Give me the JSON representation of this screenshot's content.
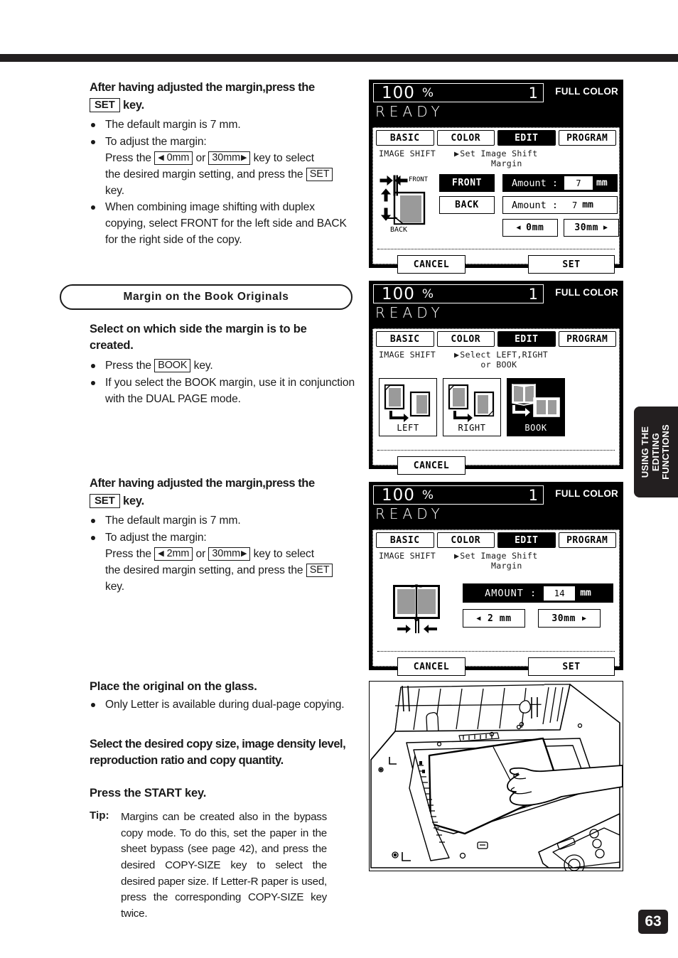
{
  "page": {
    "number": "63",
    "side_tab": "USING THE\nEDITING\nFUNCTIONS"
  },
  "steps": [
    {
      "id": "step-set-key-1",
      "heading_line1": "After having adjusted the margin,press the",
      "heading_key": "SET",
      "heading_line2": "key.",
      "bullets": [
        {
          "text": "The default margin is 7 mm."
        },
        {
          "text": "To adjust the margin:",
          "cont_pre": "Press the ",
          "key_left": "0mm",
          "cont_mid": " or ",
          "key_right": "30mm",
          "cont_post": " key to select",
          "cont_line2_pre": "the desired margin setting, and press the ",
          "key_set": "SET",
          "cont_line3": "key."
        },
        {
          "text": "When combining image shifting with duplex copying, select FRONT for the left side and BACK for the right side of the copy."
        }
      ]
    },
    {
      "id": "step-select-side",
      "heading": "Select on which side the margin is to be created.",
      "bullets": [
        {
          "pre": "Press the ",
          "key": "BOOK",
          "post": " key."
        },
        {
          "text": "If you select the  BOOK  margin, use it in conjunction with the DUAL PAGE mode."
        }
      ]
    },
    {
      "id": "step-set-key-2",
      "heading_line1": "After having adjusted the margin,press the",
      "heading_key": "SET",
      "heading_line2": "key.",
      "bullets": [
        {
          "text": "The default margin is 7 mm."
        },
        {
          "text": "To adjust the margin:",
          "cont_pre": "Press the ",
          "key_left": "2mm",
          "cont_mid": " or ",
          "key_right": "30mm",
          "cont_post": " key to select",
          "cont_line2_pre": "the desired margin setting, and press the ",
          "key_set": "SET",
          "cont_line3": "key."
        }
      ]
    },
    {
      "id": "step-place-original",
      "heading": "Place the original on the glass.",
      "bullets": [
        {
          "text": "Only Letter is available during dual-page copying."
        }
      ]
    },
    {
      "id": "step-select-copy-size",
      "heading": "Select the desired copy size, image density level, reproduction ratio and copy quantity."
    },
    {
      "id": "step-press-start",
      "heading": "Press the START key."
    }
  ],
  "section_title": "Margin on the Book Originals",
  "tip": {
    "label": "Tip:",
    "text": "Margins can be created also in the bypass copy mode. To do this, set the paper in the sheet bypass (see page 42), and press the desired COPY-SIZE key to select the desired paper size. If Letter-R paper is used, press the corresponding COPY-SIZE key twice."
  },
  "lcd_common": {
    "ratio": "100",
    "percent": "%",
    "copies": "1",
    "color_mode": "FULL COLOR",
    "status": "READY",
    "tabs": [
      {
        "label": "BASIC",
        "active": false
      },
      {
        "label": "COLOR",
        "active": false
      },
      {
        "label": "EDIT",
        "active": true
      },
      {
        "label": "PROGRAM",
        "active": false
      }
    ],
    "feature": "IMAGE SHIFT"
  },
  "lcd_panels": [
    {
      "id": "lcd-image-shift-margin-front-back",
      "prompt": "Set Image Shift\n      Margin",
      "pictogram": {
        "front_label": "FRONT",
        "back_label": "BACK"
      },
      "buttons": [
        {
          "name": "front-button",
          "label": "FRONT",
          "selected": true
        },
        {
          "name": "back-button",
          "label": "BACK",
          "selected": false
        }
      ],
      "fields": [
        {
          "name": "amount-front",
          "label": "Amount :",
          "value": "7",
          "unit": "mm",
          "selected": true
        },
        {
          "name": "amount-back",
          "label": "Amount :",
          "value": "7",
          "unit": "mm",
          "selected": false
        }
      ],
      "steppers": [
        {
          "name": "decrease-margin-button",
          "label": "0mm",
          "arrow": "left"
        },
        {
          "name": "increase-margin-button",
          "label": "30mm",
          "arrow": "right"
        }
      ],
      "cancel": "CANCEL",
      "set": "SET"
    },
    {
      "id": "lcd-select-left-right-book",
      "prompt": "Select LEFT,RIGHT\n    or BOOK",
      "choices": [
        {
          "name": "left-option",
          "label": "LEFT",
          "selected": false
        },
        {
          "name": "right-option",
          "label": "RIGHT",
          "selected": false
        },
        {
          "name": "book-option",
          "label": "BOOK",
          "selected": true
        }
      ],
      "cancel": "CANCEL"
    },
    {
      "id": "lcd-image-shift-margin-book",
      "prompt": "Set Image Shift\n      Margin",
      "fields": [
        {
          "name": "amount-book",
          "label": "AMOUNT  :",
          "value": "14",
          "unit": "mm",
          "selected": true
        }
      ],
      "steppers": [
        {
          "name": "decrease-margin-button",
          "label": "2 mm",
          "arrow": "left"
        },
        {
          "name": "increase-margin-button",
          "label": "30mm",
          "arrow": "right"
        }
      ],
      "cancel": "CANCEL",
      "set": "SET"
    }
  ],
  "photo": {
    "caption": "copier platen with book original and hand"
  }
}
